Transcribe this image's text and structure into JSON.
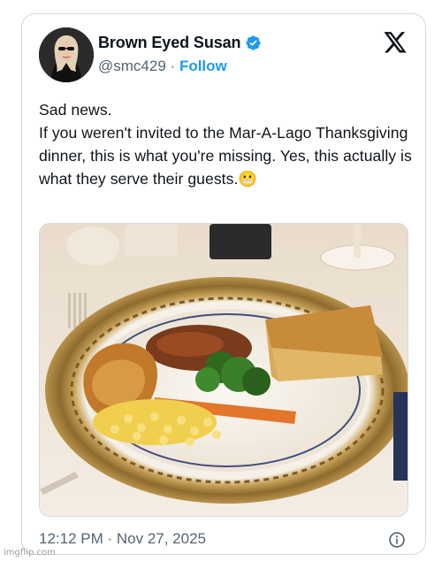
{
  "tweet": {
    "display_name": "Brown Eyed Susan",
    "handle": "@smc429",
    "separator": "·",
    "follow_label": "Follow",
    "text": "Sad news.\nIf you weren't invited to the Mar-A-Lago Thanksgiving dinner, this is what you're missing. Yes, this actually is what they serve their guests.",
    "emoji": "😬",
    "timestamp": "12:12 PM · Nov 27, 2025"
  },
  "icons": {
    "verified": "verified-badge-icon",
    "x_logo": "x-logo-icon",
    "info": "info-icon"
  },
  "colors": {
    "accent": "#1d9bf0",
    "secondary_text": "#536471",
    "border": "#cfd9de"
  },
  "watermark": "imgflip.com"
}
